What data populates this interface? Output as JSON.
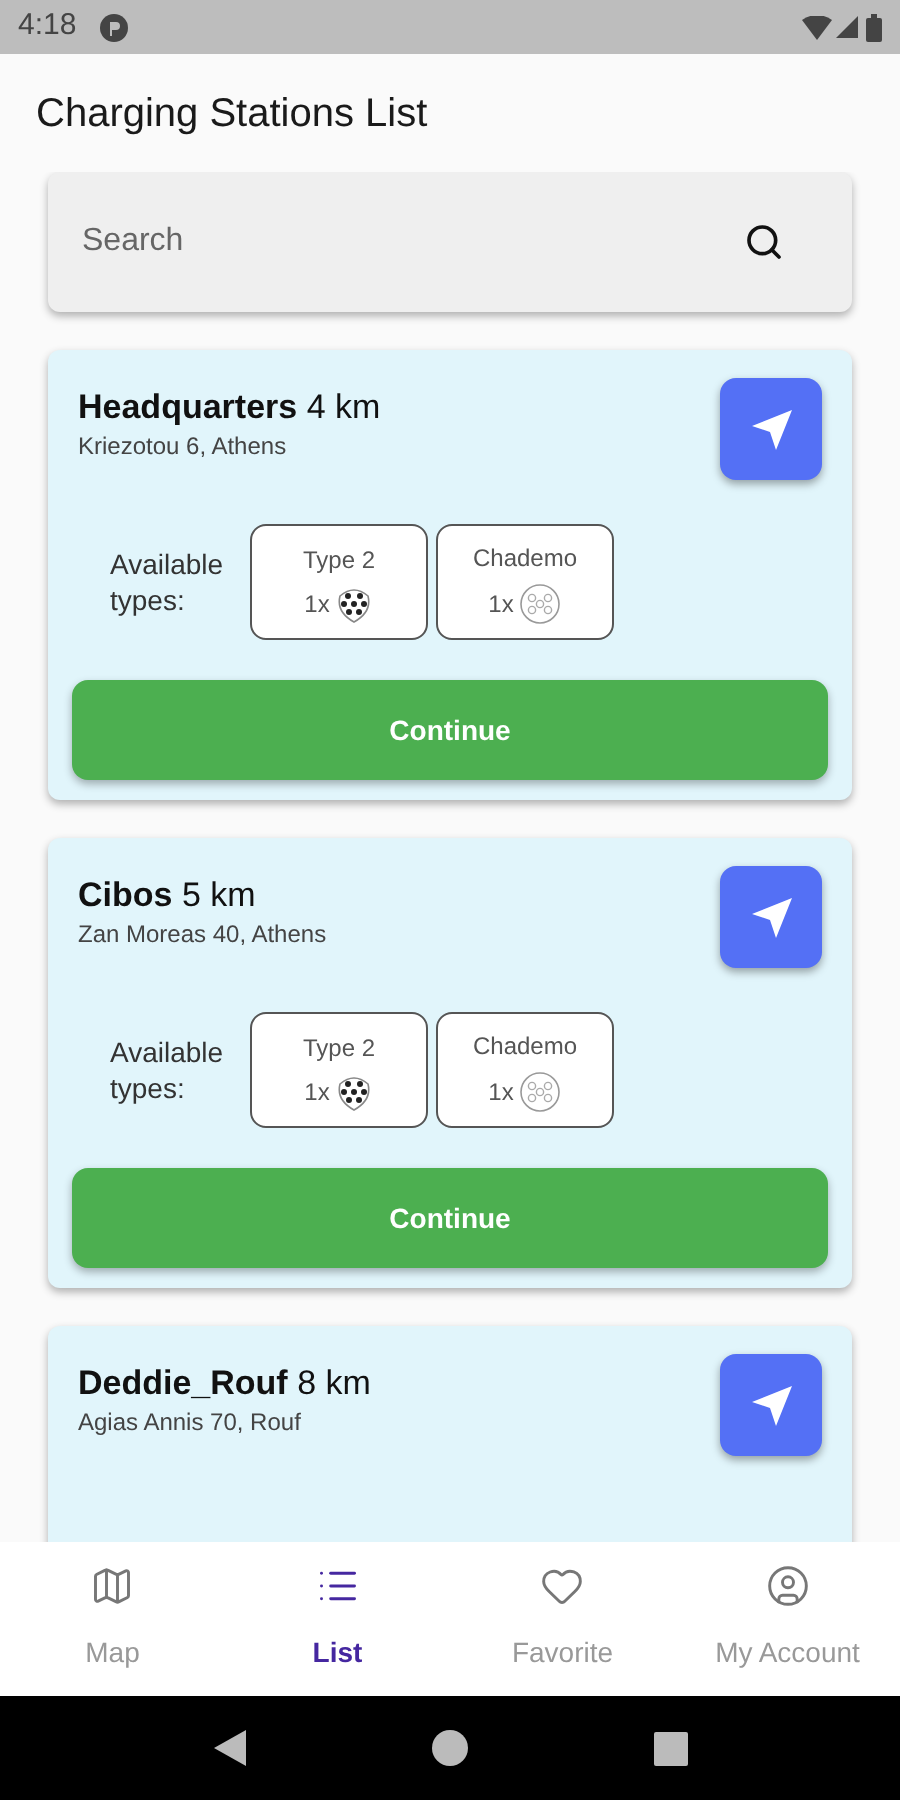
{
  "status_bar": {
    "time": "4:18"
  },
  "header": {
    "title": "Charging Stations List"
  },
  "search": {
    "placeholder": "Search"
  },
  "stations": [
    {
      "name": "Headquarters",
      "distance": "4 km",
      "address": "Kriezotou 6, Athens",
      "types_label": "Available types:",
      "connectors": [
        {
          "kind": "type2",
          "label": "Type 2",
          "count": "1x"
        },
        {
          "kind": "chademo",
          "label": "Chademo",
          "count": "1x"
        }
      ],
      "action": "Continue"
    },
    {
      "name": "Cibos",
      "distance": "5 km",
      "address": "Zan Moreas 40, Athens",
      "types_label": "Available types:",
      "connectors": [
        {
          "kind": "type2",
          "label": "Type 2",
          "count": "1x"
        },
        {
          "kind": "chademo",
          "label": "Chademo",
          "count": "1x"
        }
      ],
      "action": "Continue"
    },
    {
      "name": "Deddie_Rouf",
      "distance": "8 km",
      "address": "Agias Annis 70, Rouf"
    }
  ],
  "bottom_nav": [
    {
      "kind": "map",
      "label": "Map",
      "selected": false
    },
    {
      "kind": "list",
      "label": "List",
      "selected": true
    },
    {
      "kind": "favorite",
      "label": "Favorite",
      "selected": false
    },
    {
      "kind": "account",
      "label": "My Account",
      "selected": false
    }
  ]
}
